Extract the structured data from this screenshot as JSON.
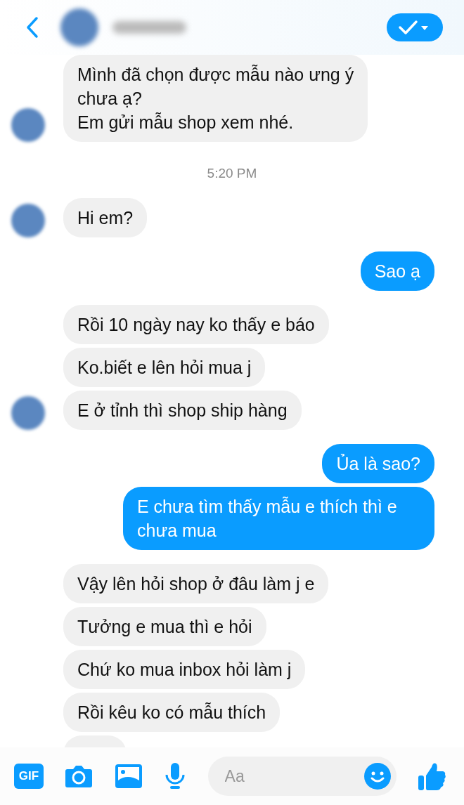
{
  "header": {
    "verified": true
  },
  "feed": [
    {
      "kind": "incoming",
      "texts": [
        "Mình đã chọn được mẫu nào ưng ý\nchưa ạ?\nEm gửi mẫu shop xem nhé."
      ]
    },
    {
      "kind": "time",
      "text": "5:20 PM"
    },
    {
      "kind": "incoming",
      "texts": [
        "Hi em?"
      ]
    },
    {
      "kind": "outgoing",
      "texts": [
        "Sao ạ"
      ]
    },
    {
      "kind": "incoming",
      "texts": [
        "Rồi 10 ngày nay ko thấy e báo",
        "Ko.biết e lên hỏi mua j",
        "E ở tỉnh thì shop ship hàng"
      ]
    },
    {
      "kind": "outgoing",
      "texts": [
        "Ủa là sao?",
        "E chưa tìm thấy mẫu e thích thì e chưa mua"
      ]
    },
    {
      "kind": "incoming",
      "texts": [
        "Vậy lên hỏi shop ở đâu làm j e",
        "Tưởng e mua thì e hỏi",
        "Chứ ko mua inbox hỏi làm j",
        "Rồi kêu ko có mẫu thích"
      ],
      "more_below": true
    }
  ],
  "composer": {
    "gif_label": "GIF",
    "placeholder": "Aa"
  }
}
